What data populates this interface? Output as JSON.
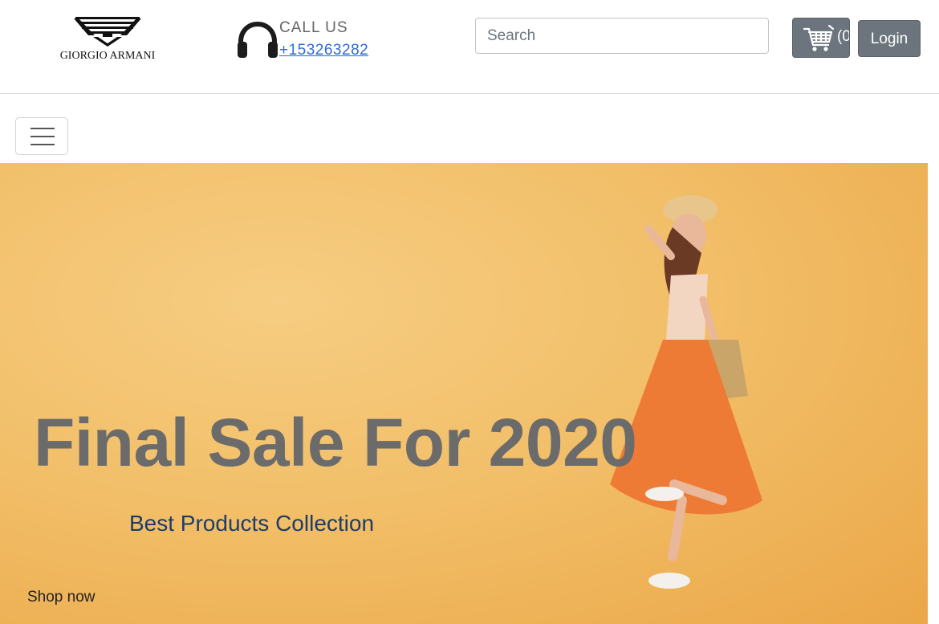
{
  "brand": {
    "name": "GIORGIO ARMANI",
    "logo_icon": "armani-eagle-logo"
  },
  "contact": {
    "label": "CALL US",
    "phone": "+153263282",
    "icon": "headphones-icon"
  },
  "search": {
    "placeholder": "Search",
    "value": ""
  },
  "cart": {
    "icon": "shopping-cart-icon",
    "count_text": "(0"
  },
  "login": {
    "label": "Login"
  },
  "nav": {
    "toggler_icon": "hamburger-menu-icon"
  },
  "hero": {
    "title": "Final Sale For 2020",
    "subtitle": "Best Products Collection",
    "cta": "Shop now"
  },
  "colors": {
    "hero_bg": "#f2bf69",
    "button_bg": "#6c757d",
    "link": "#2e6bd6",
    "hero_title": "#6b6b6b",
    "hero_subtitle": "#1d3c6b"
  }
}
